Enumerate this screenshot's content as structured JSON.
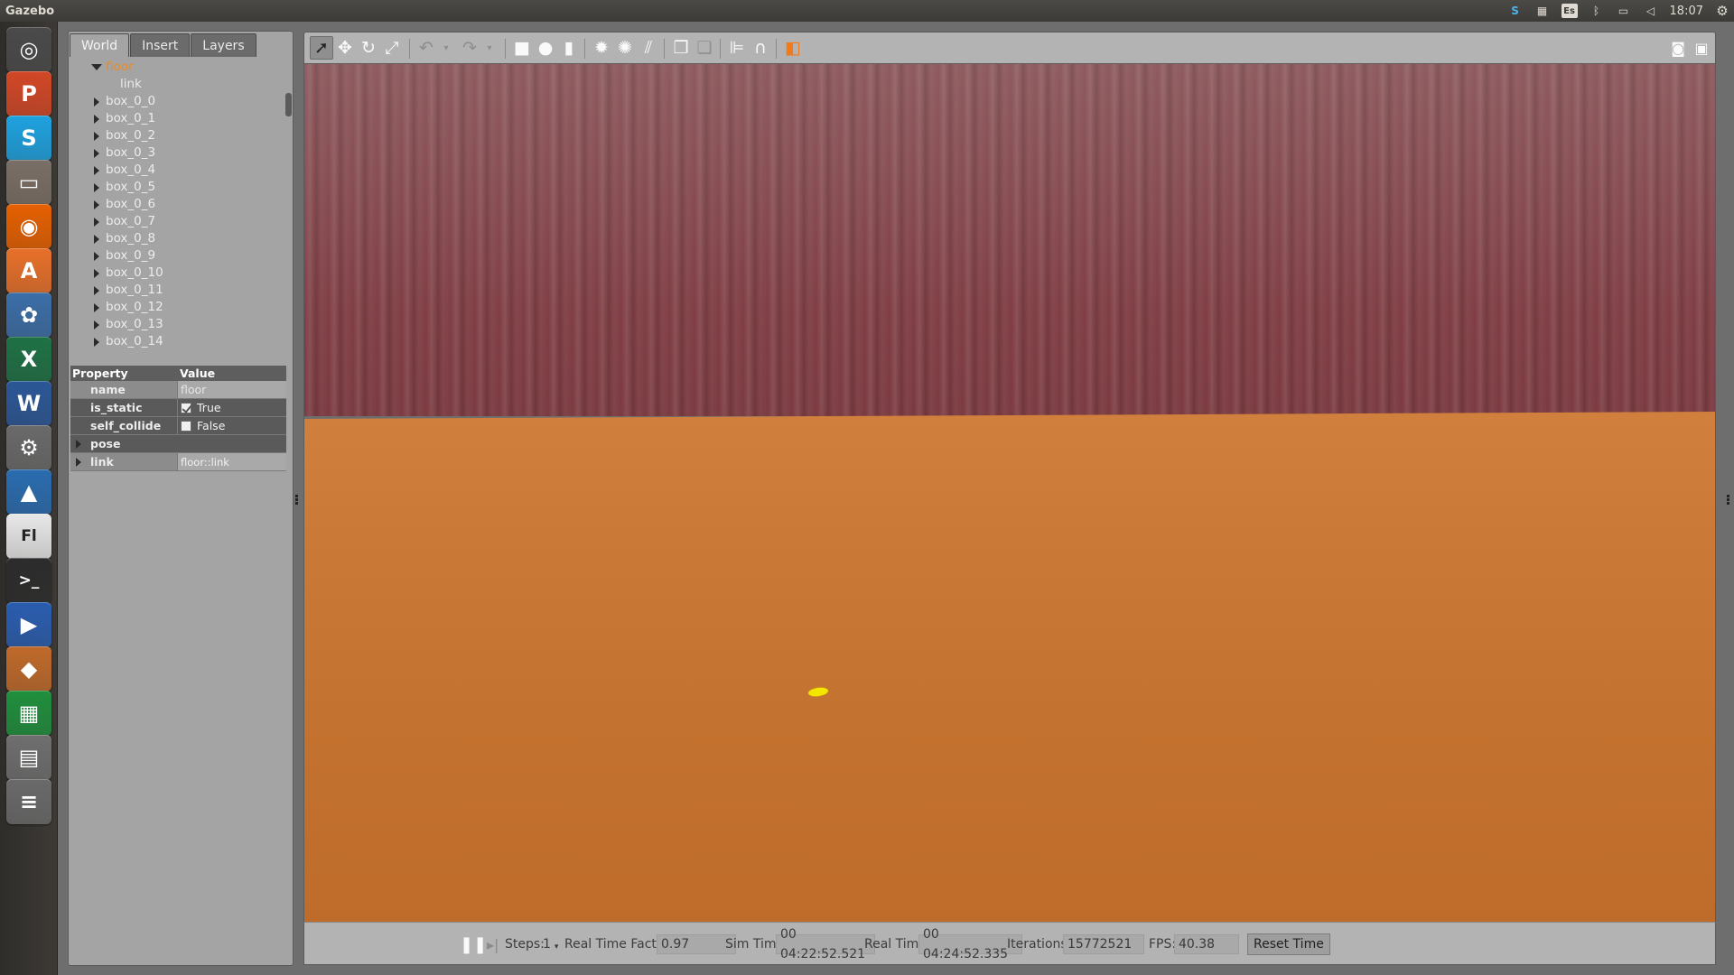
{
  "top_panel": {
    "app_title": "Gazebo",
    "tray_keyboard": "Es",
    "clock": "18:07"
  },
  "launcher": {
    "items": [
      {
        "name": "ubuntu-dash-icon",
        "glyph": "◎",
        "color": "#4a4a4a"
      },
      {
        "name": "powerpoint-icon",
        "glyph": "P",
        "color": "#d24726"
      },
      {
        "name": "skype-icon",
        "glyph": "S",
        "color": "#1ea2e0"
      },
      {
        "name": "files-icon",
        "glyph": "▭",
        "color": "#7a6f66"
      },
      {
        "name": "firefox-icon",
        "glyph": "◉",
        "color": "#e66000"
      },
      {
        "name": "software-center-icon",
        "glyph": "A",
        "color": "#e8702a"
      },
      {
        "name": "picasa-icon",
        "glyph": "✿",
        "color": "#3b6ea8"
      },
      {
        "name": "excel-icon",
        "glyph": "X",
        "color": "#1e7145"
      },
      {
        "name": "word-icon",
        "glyph": "W",
        "color": "#2b5797"
      },
      {
        "name": "system-settings-icon",
        "glyph": "⚙",
        "color": "#6a6a6a"
      },
      {
        "name": "matlab-icon",
        "glyph": "▲",
        "color": "#2a6cb0"
      },
      {
        "name": "fluid-ed-icon",
        "glyph": "Fl",
        "color": "#e8e8e8"
      },
      {
        "name": "terminal-icon",
        "glyph": ">_",
        "color": "#2c2c2c"
      },
      {
        "name": "media-player-icon",
        "glyph": "▶",
        "color": "#2a5db0"
      },
      {
        "name": "virtualbox-icon",
        "glyph": "◆",
        "color": "#c06a2a"
      },
      {
        "name": "calc-icon",
        "glyph": "▦",
        "color": "#1f8f3d"
      },
      {
        "name": "workspace-icon",
        "glyph": "▤",
        "color": "#6f6f6f"
      },
      {
        "name": "trash-icon",
        "glyph": "≡",
        "color": "#6a6a6a"
      }
    ]
  },
  "left_panel": {
    "tabs": [
      "World",
      "Insert",
      "Layers"
    ],
    "tree": {
      "root": "floor",
      "root_child": "link",
      "items": [
        "box_0_0",
        "box_0_1",
        "box_0_2",
        "box_0_3",
        "box_0_4",
        "box_0_5",
        "box_0_6",
        "box_0_7",
        "box_0_8",
        "box_0_9",
        "box_0_10",
        "box_0_11",
        "box_0_12",
        "box_0_13",
        "box_0_14"
      ]
    },
    "properties": {
      "header_property": "Property",
      "header_value": "Value",
      "rows": [
        {
          "name": "name",
          "value": "floor"
        },
        {
          "name": "is_static",
          "value": "True",
          "checked": true
        },
        {
          "name": "self_collide",
          "value": "False",
          "checked": false
        },
        {
          "name": "pose",
          "value": ""
        },
        {
          "name": "link",
          "value": "floor::link"
        }
      ]
    }
  },
  "bottom_bar": {
    "steps_label": "Steps:",
    "steps_value": "1",
    "rtf_label": "Real Time Factor:",
    "rtf_value": "0.97",
    "sim_time_label": "Sim Time:",
    "sim_time_value": "00 04:22:52.521",
    "real_time_label": "Real Time:",
    "real_time_value": "00 04:24:52.335",
    "iterations_label": "Iterations:",
    "iterations_value": "15772521",
    "fps_label": "FPS:",
    "fps_value": "40.38",
    "reset_label": "Reset Time"
  },
  "colors": {
    "wall": "#7f3e44",
    "floor": "#c4722f",
    "marker": "#f5e600",
    "tree_selected": "#f0891e"
  }
}
